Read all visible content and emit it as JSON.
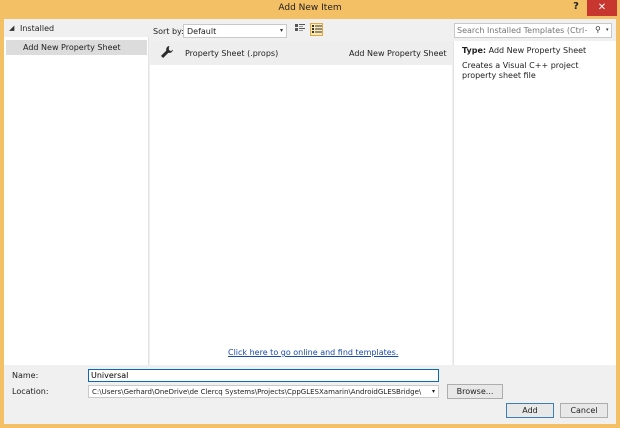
{
  "window": {
    "title": "Add New Item",
    "help": "?",
    "close": "✕"
  },
  "left": {
    "installed_label": "Installed",
    "arrow": "◢",
    "item": "Add New Property Sheet"
  },
  "toolbar": {
    "sort_label": "Sort by:",
    "sort_value": "Default",
    "dropdown_arrow": "▾"
  },
  "templates": [
    {
      "name": "Property Sheet (.props)",
      "language": "Add New Property Sheet"
    }
  ],
  "online_link": "Click here to go online and find templates.",
  "search": {
    "placeholder": "Search Installed Templates (Ctrl+E)",
    "icon_glyph": "⚲",
    "arrow": "▾"
  },
  "details": {
    "type_label": "Type:",
    "type_value": "Add New Property Sheet",
    "description": "Creates a Visual C++ project property sheet file"
  },
  "form": {
    "name_label": "Name:",
    "name_value": "Universal",
    "location_label": "Location:",
    "location_value": "C:\\Users\\Gerhard\\OneDrive\\de Clercq Systems\\Projects\\CppGLESXamarin\\AndroidGLESBridge\\",
    "browse": "Browse...",
    "add": "Add",
    "cancel": "Cancel"
  }
}
